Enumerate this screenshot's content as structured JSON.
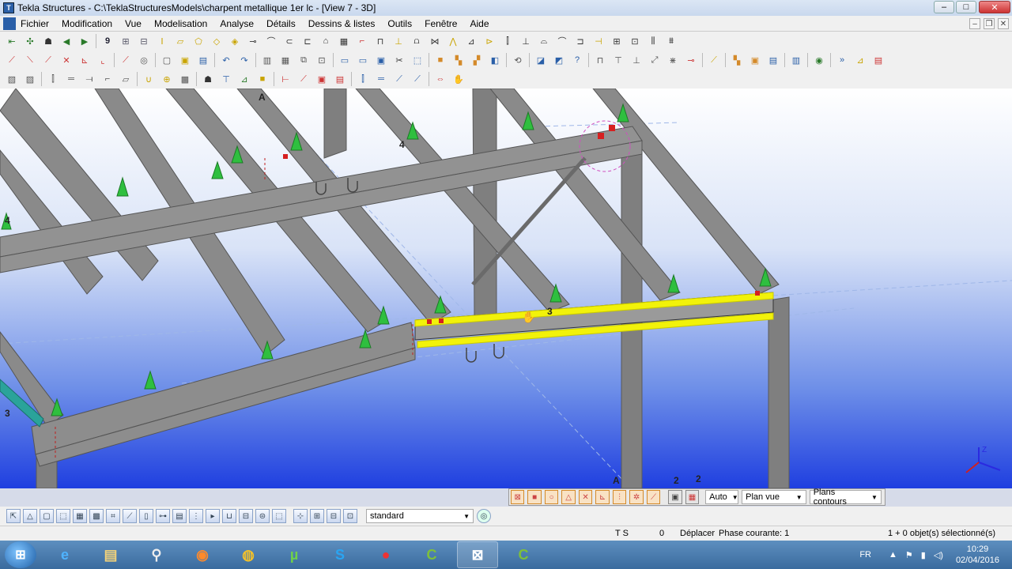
{
  "window": {
    "title": "Tekla Structures - C:\\TeklaStructuresModels\\charpent metallique 1er lc - [View 7 - 3D]",
    "minimize": "–",
    "maximize": "□",
    "close": "✕"
  },
  "menu": {
    "items": [
      "Fichier",
      "Modification",
      "Vue",
      "Modelisation",
      "Analyse",
      "Détails",
      "Dessins & listes",
      "Outils",
      "Fenêtre",
      "Aide"
    ],
    "mdi_min": "–",
    "mdi_restore": "❐",
    "mdi_close": "✕"
  },
  "viewport": {
    "grid_labels": {
      "a_top": "A",
      "four_top": "4",
      "four_left": "4",
      "three_left": "3",
      "three_mid": "3",
      "a_bottom": "A",
      "two_1": "2",
      "two_2": "2"
    },
    "colors": {
      "highlight": "#f2f20a",
      "steel": "#8a8a8a",
      "support": "#2fbf3f"
    }
  },
  "snap_toolbar": {
    "auto": "Auto",
    "plane": "Plan vue",
    "contours": "Plans contours"
  },
  "selection_toolbar": {
    "filter": "standard"
  },
  "statusbar": {
    "ts": "T S",
    "zero": "0",
    "command": "Déplacer",
    "phase": "Phase courante: 1",
    "selection": "1 + 0 objet(s) sélectionné(s)"
  },
  "taskbar": {
    "lang": "FR",
    "time": "10:29",
    "date": "02/04/2016"
  }
}
